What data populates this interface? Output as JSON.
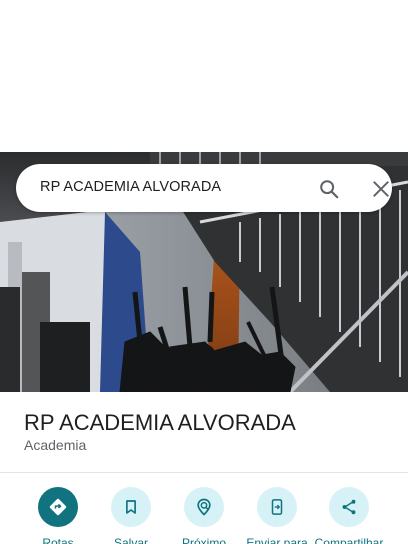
{
  "search": {
    "query": "RP ACADEMIA ALVORADA"
  },
  "place": {
    "name": "RP ACADEMIA ALVORADA",
    "category": "Academia"
  },
  "actions": [
    {
      "label": "Rotas",
      "icon": "directions-icon"
    },
    {
      "label": "Salvar",
      "icon": "bookmark-icon"
    },
    {
      "label": "Próximo",
      "icon": "nearby-icon"
    },
    {
      "label": "Enviar para",
      "icon": "send-to-phone-icon"
    },
    {
      "label": "Compartilhar",
      "icon": "share-icon"
    }
  ],
  "colors": {
    "accent": "#11737f",
    "action_bg": "#d7f2f7",
    "text_secondary": "#5f6368"
  }
}
